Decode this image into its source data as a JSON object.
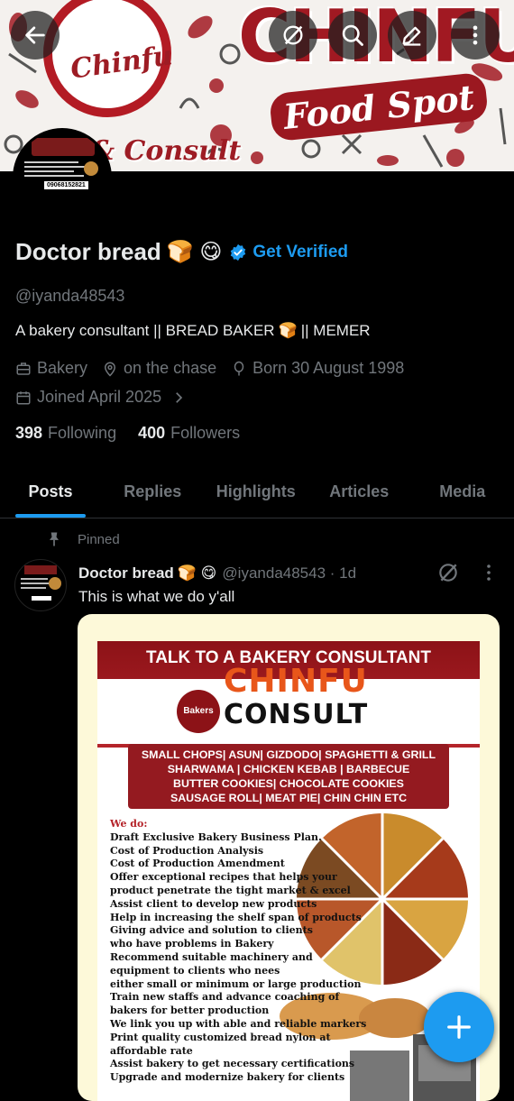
{
  "banner": {
    "logo_word": "Chinfu",
    "consult_word": "& Consult",
    "brand_word": "CHINFU",
    "brand_sub": "Food Spot"
  },
  "toolbar": {
    "back_icon": "arrow-left-icon",
    "grok_icon": "grok-icon",
    "search_icon": "search-icon",
    "edit_icon": "edit-icon",
    "more_icon": "more-vertical-icon"
  },
  "avatar_phone": "09068152821",
  "profile": {
    "name": "Doctor bread",
    "name_emojis": "🍞 😋",
    "verified_label": "Get Verified",
    "handle": "@iyanda48543",
    "bio_part1": "A bakery consultant || BREAD BAKER",
    "bio_emoji": "🍞",
    "bio_part2": "|| MEMER",
    "category": "Bakery",
    "location": "on the chase",
    "born": "Born 30 August 1998",
    "joined": "Joined April 2025",
    "following_count": "398",
    "following_label": "Following",
    "followers_count": "400",
    "followers_label": "Followers"
  },
  "tabs": [
    "Posts",
    "Replies",
    "Highlights",
    "Articles",
    "Media"
  ],
  "post": {
    "pinned_label": "Pinned",
    "author": "Doctor bread",
    "author_emojis": "🍞 😋",
    "handle_time": "@iyanda48543 · 1d",
    "text": "This is what we do y'all"
  },
  "flyer": {
    "heading": "TALK TO A BAKERY CONSULTANT",
    "brand": "CHINFU",
    "brand2": "CONSULT",
    "badge": "Bakers",
    "services": [
      "SMALL CHOPS| ASUN| GIZDODO| SPAGHETTI & GRILL",
      "SHARWAMA | CHICKEN KEBAB | BARBECUE",
      "BUTTER COOKIES| CHOCOLATE COOKIES",
      "SAUSAGE ROLL| MEAT PIE| CHIN CHIN ETC"
    ],
    "we_do": "We do:",
    "list": [
      "Draft Exclusive Bakery Business Plan.",
      "Cost of Production Analysis",
      "Cost of Production Amendment",
      "Offer exceptional recipes that helps your",
      "product penetrate the tight market & excel",
      "Assist client to develop new products",
      "Help in increasing the shelf span of products",
      "Giving advice and solution to clients",
      "who have problems in Bakery",
      "Recommend suitable machinery and",
      "equipment to clients who nees",
      "either small or minimum or large production",
      "Train new staffs and advance coaching of",
      "bakers for better production",
      "We link you up with able and reliable markers",
      "Print quality customized bread nylon at",
      "affordable rate",
      "Assist bakery to get necessary certifications",
      "Upgrade and modernize bakery for clients"
    ]
  },
  "fab_icon": "plus-icon"
}
